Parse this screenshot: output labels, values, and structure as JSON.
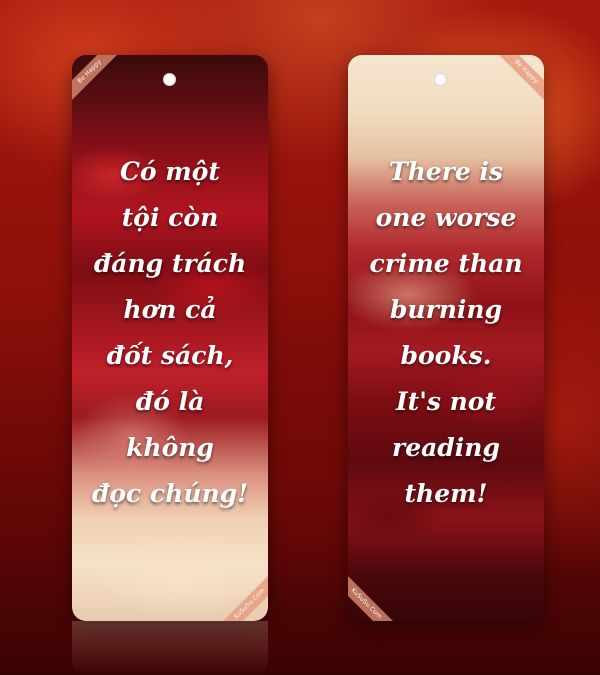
{
  "bookmarks": [
    {
      "top_ribbon": "Be Happy",
      "bottom_ribbon": "KuSuSu.Com",
      "lines": [
        "Có một",
        "tội còn",
        "đáng trách",
        "hơn cả",
        "đốt sách,",
        "đó là",
        "không",
        "đọc chúng!"
      ]
    },
    {
      "top_ribbon": "Be Happy",
      "bottom_ribbon": "KuSuSu.Com",
      "lines": [
        "There is",
        "one worse",
        "crime than",
        "burning",
        "books.",
        "It's not",
        "reading",
        "them!"
      ]
    }
  ],
  "colors": {
    "background": "#8c0f0a",
    "text": "#ffffff",
    "ribbon": "#e6967a"
  }
}
